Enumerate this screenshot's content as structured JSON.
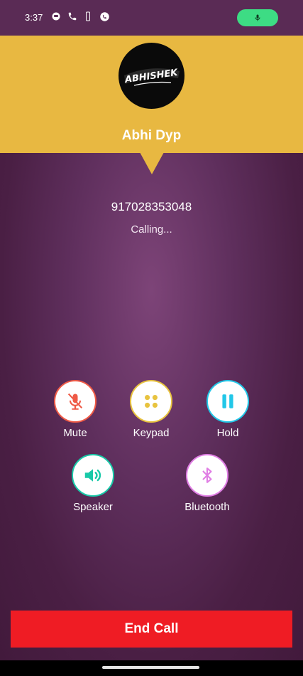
{
  "status_bar": {
    "time": "3:37",
    "icons": [
      "notification-icon",
      "phone-icon",
      "battery-icon",
      "whatsapp-icon"
    ],
    "mic_indicator_color": "#3ddc84"
  },
  "contact": {
    "avatar_text": "ABHISHEK",
    "name": "Abhi Dyp",
    "number": "917028353048",
    "status": "Calling..."
  },
  "controls": {
    "mute": {
      "label": "Mute",
      "color": "#ef5a46",
      "icon": "mic-off-icon"
    },
    "keypad": {
      "label": "Keypad",
      "color": "#e8c33f",
      "icon": "keypad-icon"
    },
    "hold": {
      "label": "Hold",
      "color": "#22c7e8",
      "icon": "pause-icon"
    },
    "speaker": {
      "label": "Speaker",
      "color": "#18c9a8",
      "icon": "speaker-icon"
    },
    "bluetooth": {
      "label": "Bluetooth",
      "color": "#e07ee4",
      "icon": "bluetooth-icon"
    }
  },
  "end_call": {
    "label": "End Call",
    "color": "#ef1c24"
  },
  "colors": {
    "header": "#e8b841",
    "background": "#5f2f5d"
  }
}
